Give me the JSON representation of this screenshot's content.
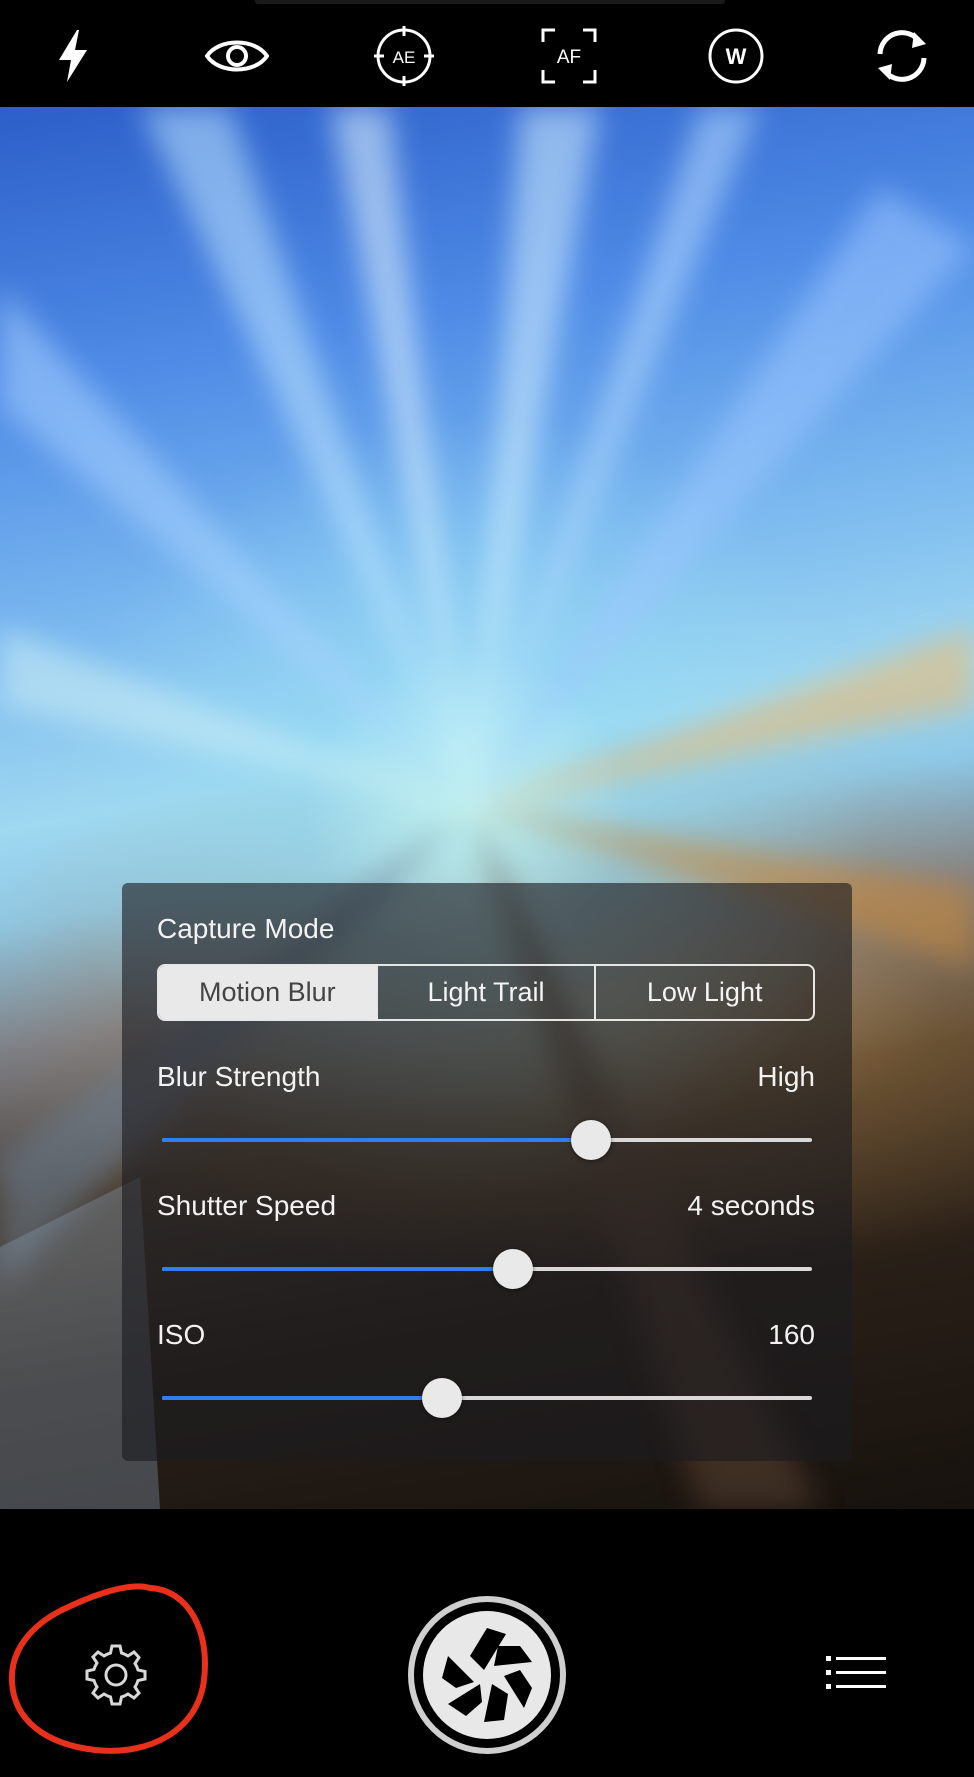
{
  "toolbar": {
    "icons": [
      "flash-icon",
      "eye-icon",
      "ae-lock-icon",
      "af-lock-icon",
      "white-balance-icon",
      "switch-camera-icon"
    ],
    "ae_label": "AE",
    "af_label": "AF",
    "wb_label": "W"
  },
  "panel": {
    "title": "Capture Mode",
    "modes": [
      "Motion Blur",
      "Light Trail",
      "Low Light"
    ],
    "selected_mode": "Motion Blur",
    "accent_color": "#2f7ff2",
    "sliders": [
      {
        "label": "Blur Strength",
        "value": "High",
        "level": 0.66
      },
      {
        "label": "Shutter Speed",
        "value": "4 seconds",
        "level": 0.54
      },
      {
        "label": "ISO",
        "value": "160",
        "level": 0.43
      }
    ]
  },
  "bottom": {
    "icons": [
      "settings-gear-icon",
      "shutter-button",
      "menu-list-icon"
    ],
    "annotation_color": "#e8301a"
  }
}
